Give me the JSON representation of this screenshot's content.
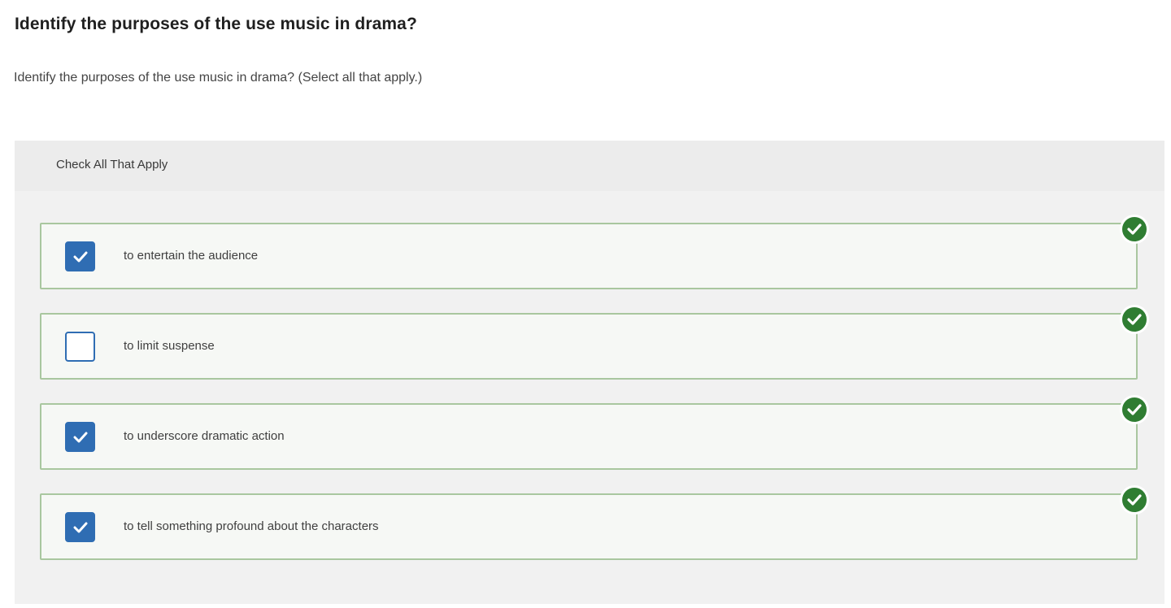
{
  "question": {
    "title": "Identify the purposes of the use music in drama?",
    "prompt": "Identify the purposes of the use music in drama? (Select all that apply.)"
  },
  "panel": {
    "header": "Check All That Apply"
  },
  "options": [
    {
      "label": "to entertain the audience",
      "checked": true,
      "status": "correct"
    },
    {
      "label": "to limit suspense",
      "checked": false,
      "status": "correct"
    },
    {
      "label": "to underscore dramatic action",
      "checked": true,
      "status": "correct"
    },
    {
      "label": "to tell something profound about the characters",
      "checked": true,
      "status": "correct"
    }
  ],
  "colors": {
    "checkbox_blue": "#2f6db3",
    "correct_green": "#2f7d32",
    "option_border": "#a9c79f"
  },
  "icons": {
    "checkbox_checked": "checkmark-icon",
    "correct_indicator": "check-circle-icon"
  }
}
